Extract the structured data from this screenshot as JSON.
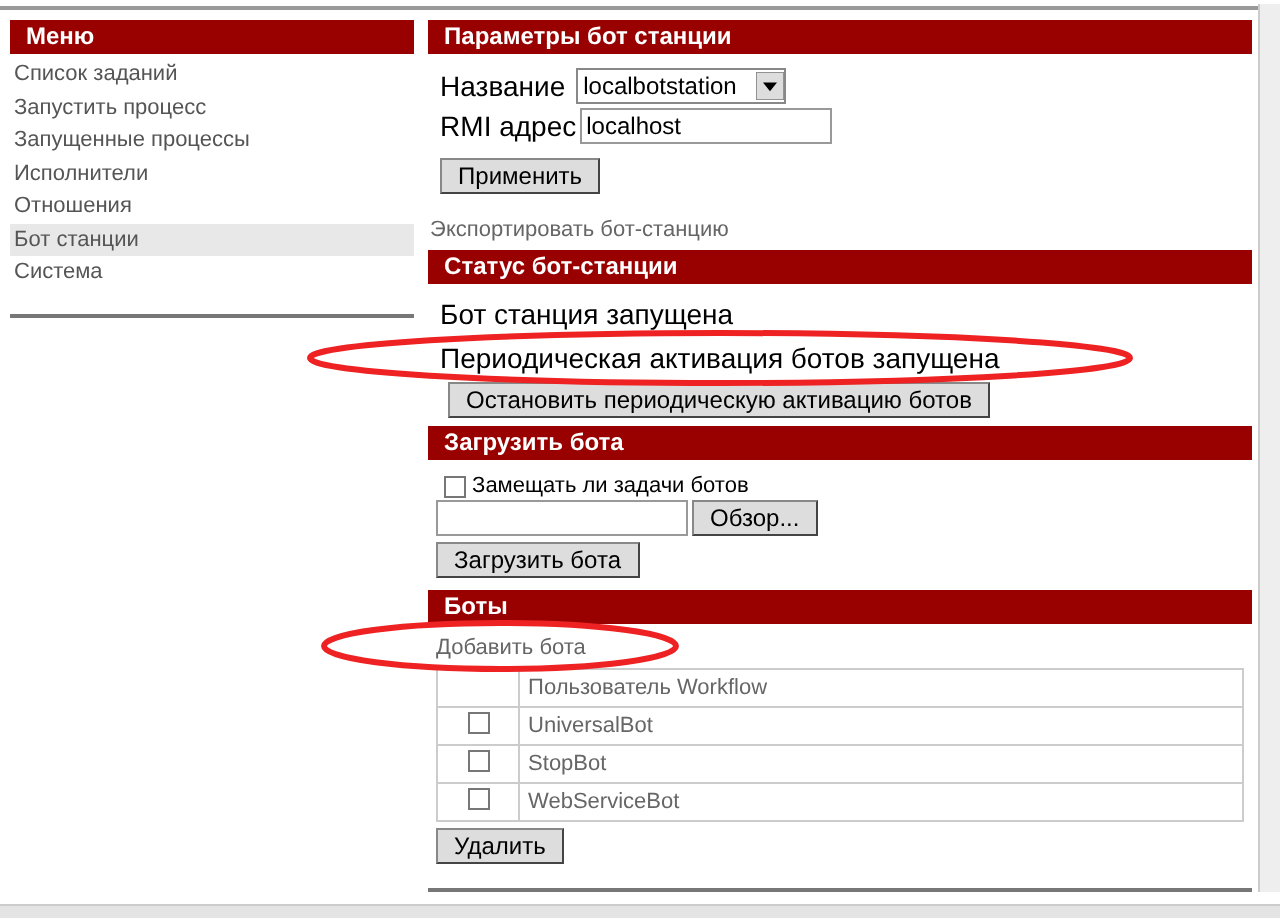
{
  "menu": {
    "title": "Меню",
    "items": [
      {
        "label": "Список заданий",
        "selected": false
      },
      {
        "label": "Запустить процесс",
        "selected": false
      },
      {
        "label": "Запущенные процессы",
        "selected": false
      },
      {
        "label": "Исполнители",
        "selected": false
      },
      {
        "label": "Отношения",
        "selected": false
      },
      {
        "label": "Бот станции",
        "selected": true
      },
      {
        "label": "Система",
        "selected": false
      }
    ]
  },
  "params": {
    "title": "Параметры бот станции",
    "name_label": "Название",
    "name_value": "localbotstation",
    "rmi_label": "RMI адрес",
    "rmi_value": "localhost",
    "apply_button": "Применить",
    "export_link": "Экспортировать бот-станцию"
  },
  "status": {
    "title": "Статус бот-станции",
    "lines": [
      "Бот станция запущена",
      "Периодическая активация ботов запущена"
    ],
    "stop_button": "Остановить периодическую активацию ботов"
  },
  "upload": {
    "title": "Загрузить бота",
    "replace_label": "Замещать ли задачи ботов",
    "replace_checked": false,
    "browse_button": "Обзор...",
    "upload_button": "Загрузить бота"
  },
  "bots": {
    "title": "Боты",
    "add_link": "Добавить бота",
    "column_header": "Пользователь Workflow",
    "rows": [
      {
        "name": "UniversalBot",
        "checked": false
      },
      {
        "name": "StopBot",
        "checked": false
      },
      {
        "name": "WebServiceBot",
        "checked": false
      }
    ],
    "delete_button": "Удалить"
  }
}
